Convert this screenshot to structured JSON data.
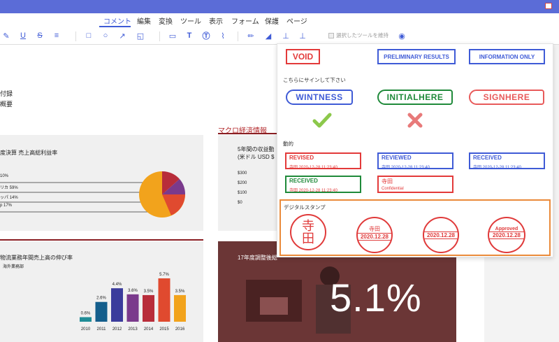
{
  "menu": [
    "コメント",
    "編集",
    "変換",
    "ツール",
    "表示",
    "フォーム",
    "保護",
    "ページ"
  ],
  "toolbar": {
    "keep_tool_label": "選択したツールを維持"
  },
  "document": {
    "left_text_1": "付録",
    "left_text_2": "概要",
    "card1_title": "度決算 売上高総利益率",
    "pie_labels": [
      "10%",
      "リカ 59%",
      "ッパ 14%",
      "p 17%"
    ],
    "macro_title": "マクロ経済情報",
    "card2_title_1": "5年間の収益動",
    "card2_title_2": "(米ドル USD $",
    "card2_axis": [
      "$300",
      "$200",
      "$100",
      "$0"
    ],
    "card3_title": "物流業務年間売上高の伸び率",
    "card3_subtitle": "海外業務部",
    "bars": [
      {
        "year": "2010",
        "value": "0.6%",
        "pct": 0.6,
        "color": "#1f8c96"
      },
      {
        "year": "2011",
        "value": "2.6%",
        "pct": 2.6,
        "color": "#145e8c"
      },
      {
        "year": "2012",
        "value": "4.4%",
        "pct": 4.4,
        "color": "#3b3c9c"
      },
      {
        "year": "2013",
        "value": "3.6%",
        "pct": 3.6,
        "color": "#7a3a8c"
      },
      {
        "year": "2014",
        "value": "3.5%",
        "pct": 3.5,
        "color": "#b82d3a"
      },
      {
        "year": "2015",
        "value": "5.7%",
        "pct": 5.7,
        "color": "#e04a2f"
      },
      {
        "year": "2016",
        "value": "3.5%",
        "pct": 3.5,
        "color": "#f2a31c"
      }
    ],
    "photo_caption": "17年度調整後総",
    "photo_big": "5.1%"
  },
  "panel": {
    "standard": [
      "VOID",
      "PRELIMINARY RESULTS",
      "INFORMATION ONLY"
    ],
    "sign_here_label": "こちらにサインして下さい",
    "sign_tags": [
      "WINTNESS",
      "INITIALHERE",
      "SIGNHERE"
    ],
    "dynamic_label": "動的",
    "dynamic": [
      {
        "title": "REVISED",
        "sub": "寺田  2020-12-28 11:23:40",
        "color": "#e33a3a"
      },
      {
        "title": "REVIEWED",
        "sub": "寺田  2020-12-28 11:23:40",
        "color": "#3f5bd6"
      },
      {
        "title": "RECEIVED",
        "sub": "寺田  2020-12-28 11:23:40",
        "color": "#3f5bd6"
      },
      {
        "title": "RECEIVED",
        "sub": "寺田  2020-12-28 11:23:40",
        "color": "#1f8a3a"
      },
      {
        "title": "寺田",
        "sub": "Confidential",
        "color": "#e33a3a"
      }
    ],
    "digital_label": "デジタルスタンプ",
    "seal1_top": "寺",
    "seal1_bottom": "田",
    "seal2_top": "寺田",
    "seal2_date": "2020.12.28",
    "seal3_date": "2020.12.28",
    "seal4_top": "Approved",
    "seal4_date": "2020.12.28"
  }
}
